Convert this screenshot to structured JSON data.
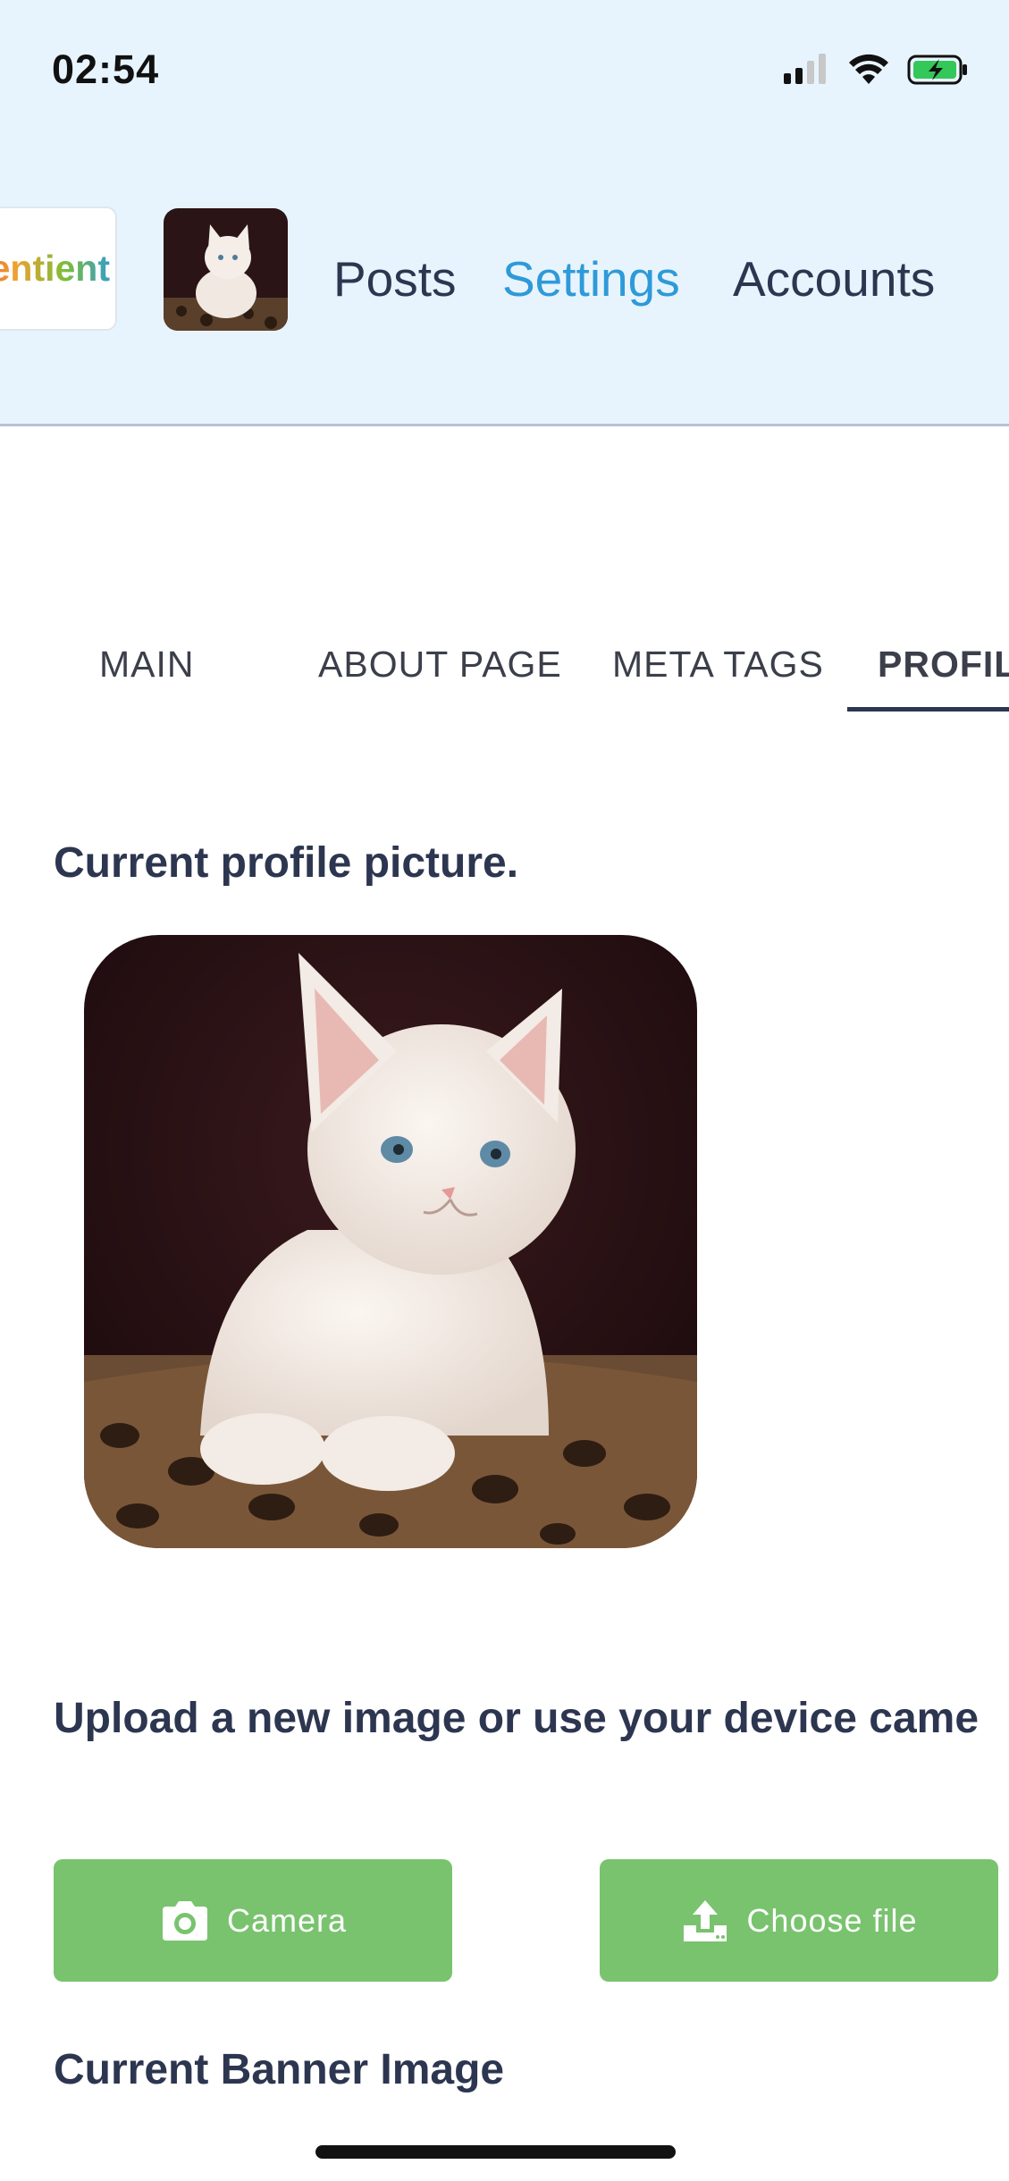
{
  "status_bar": {
    "time": "02:54"
  },
  "header": {
    "logo_text": "Sentient",
    "nav": [
      {
        "label": "Posts"
      },
      {
        "label": "Settings"
      },
      {
        "label": "Accounts"
      }
    ]
  },
  "tabs": [
    {
      "label": "MAIN"
    },
    {
      "label": "ABOUT PAGE"
    },
    {
      "label": "META TAGS"
    },
    {
      "label": "PROFIL"
    }
  ],
  "profile": {
    "heading": "Current profile picture.",
    "upload_heading": "Upload a new image or use your device came",
    "camera_label": "Camera",
    "choose_file_label": "Choose file",
    "banner_heading": "Current Banner Image"
  },
  "colors": {
    "header_bg": "#e8f4fd",
    "accent": "#2e9ad8",
    "button_green": "#79c36e",
    "text_dark": "#2d3650"
  }
}
